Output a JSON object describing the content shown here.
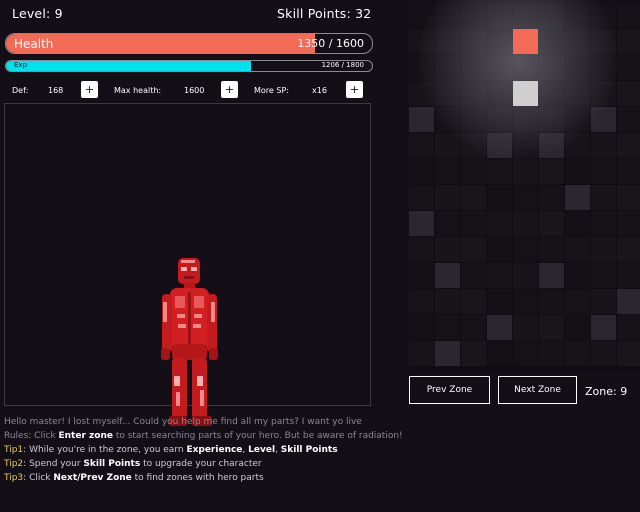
{
  "header": {
    "level": "Level: 9",
    "skill_points": "Skill Points: 32"
  },
  "health": {
    "label": "Health",
    "value": "1350 / 1600",
    "fraction": 0.84375,
    "color": "#f36a57"
  },
  "exp": {
    "label": "Exp",
    "value": "1206 / 1800",
    "fraction": 0.67,
    "color": "#00e1ee"
  },
  "stats": {
    "def_label": "Def:",
    "def_value": "168",
    "maxhp_label": "Max health:",
    "maxhp_value": "1600",
    "moresp_label": "More SP:",
    "moresp_value": "x16",
    "plus": "+"
  },
  "zone": {
    "prev": "Prev Zone",
    "next": "Next Zone",
    "label": "Zone: 9",
    "highlight_colors": {
      "hero_part": "#f36a57",
      "light": "#cfcfcf"
    }
  },
  "messages": {
    "intro": "Hello master! I lost myself... Could you help me find all my parts? I want yo live",
    "rules_prefix": "Rules: Click ",
    "rules_key": "Enter zone",
    "rules_suffix": " to start searching parts of your hero. But be aware of radiation!",
    "tip1_key": "Tip1",
    "tip1_a": ": While you're in the zone, you earn ",
    "tip1_b1": "Experience",
    "tip1_c": ", ",
    "tip1_b2": "Level",
    "tip1_d": ", ",
    "tip1_b3": "Skill Points",
    "tip2_key": "Tip2",
    "tip2_a": ": Spend your ",
    "tip2_b": "Skill Points",
    "tip2_c": " to upgrade your character",
    "tip3_key": "Tip3",
    "tip3_a": ": Click ",
    "tip3_b": "Next/Prev Zone",
    "tip3_c": " to find zones with hero parts"
  }
}
